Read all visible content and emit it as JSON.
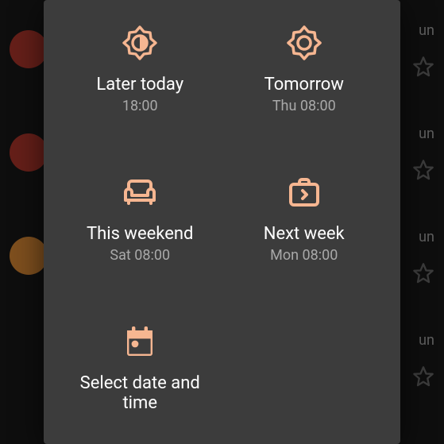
{
  "background": {
    "date_label": "un",
    "avatars": [
      {
        "color": "#b83a2f"
      },
      {
        "color": "#b83a2f"
      },
      {
        "color": "#e69138"
      }
    ]
  },
  "snooze_options": {
    "later_today": {
      "label": "Later today",
      "sub": "18:00"
    },
    "tomorrow": {
      "label": "Tomorrow",
      "sub": "Thu 08:00"
    },
    "this_weekend": {
      "label": "This weekend",
      "sub": "Sat 08:00"
    },
    "next_week": {
      "label": "Next week",
      "sub": "Mon 08:00"
    },
    "custom": {
      "label": "Select date and time",
      "sub": ""
    }
  }
}
